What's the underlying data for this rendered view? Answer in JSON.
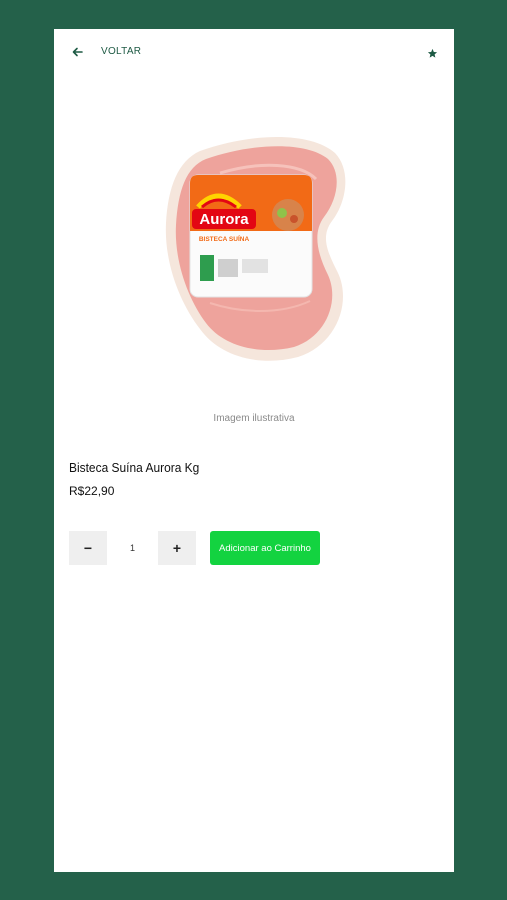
{
  "header": {
    "back_label": "VOLTAR",
    "back_icon": "arrow-left-icon",
    "favorite_icon": "star-icon"
  },
  "product": {
    "image_brand": "Aurora",
    "image_subtitle": "BISTECA SUÍNA",
    "image_caption": "Imagem ilustrativa",
    "name": "Bisteca Suína Aurora Kg",
    "price": "R$22,90"
  },
  "cart": {
    "decrement_label": "−",
    "quantity": "1",
    "increment_label": "+",
    "add_label": "Adicionar ao Carrinho"
  },
  "colors": {
    "background": "#24614a",
    "accent": "#13d340",
    "text_dark": "#1e5a44"
  }
}
